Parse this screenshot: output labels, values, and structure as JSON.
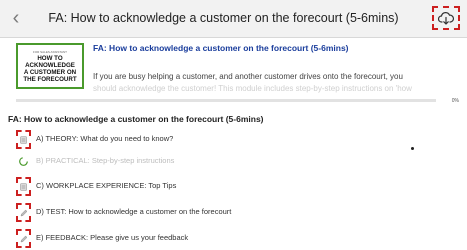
{
  "header": {
    "back_icon": "chevron-left-icon",
    "title": "FA: How to acknowledge a customer on the forecourt (5-6mins)",
    "download_icon": "cloud-download-icon"
  },
  "module": {
    "thumbnail": {
      "small_text": "FOR SALES ASSISTANT",
      "lines": [
        "HOW TO",
        "ACKNOWLEDGE",
        "A CUSTOMER ON",
        "THE FORECOURT"
      ]
    },
    "title": "FA: How to acknowledge a customer on the forecourt (5-6mins)",
    "description": "If you are busy helping a customer, and another customer drives onto the forecourt, you",
    "description_faded": "should acknowledge the customer! This module includes step-by-step instructions on 'how",
    "progress_percent": 0,
    "progress_label": "0%"
  },
  "section": {
    "title": "FA: How to acknowledge a customer on the forecourt (5-6mins)"
  },
  "steps": [
    {
      "label": "A) THEORY: What do you need to know?",
      "icon": "document-icon",
      "dimmed": false
    },
    {
      "label": "B) PRACTICAL: Step-by-step instructions",
      "icon": "check-circle-icon",
      "dimmed": true
    },
    {
      "label": "C) WORKPLACE EXPERIENCE: Top Tips",
      "icon": "document-icon",
      "dimmed": false
    },
    {
      "label": "D) TEST: How to acknowledge a customer on the forecourt",
      "icon": "pencil-icon",
      "dimmed": false
    },
    {
      "label": "E) FEEDBACK: Please give us your feedback",
      "icon": "pencil-icon",
      "dimmed": false
    }
  ],
  "colors": {
    "accent_green": "#4a9a2c",
    "link_blue": "#1a3d9c",
    "highlight_red": "#cc1f1f"
  }
}
